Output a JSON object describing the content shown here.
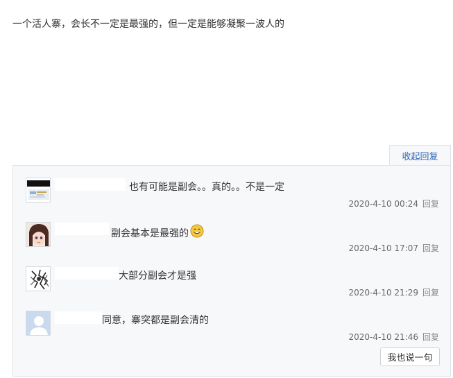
{
  "post": {
    "content": "一个活人寨，会长不一定是最强的，但一定是能够凝聚一波人的"
  },
  "replies_panel": {
    "collapse_label": "收起回复",
    "reply_label": "回复",
    "say_button_label": "我也说一句",
    "items": [
      {
        "text": "也有可能是副会。。真的。。不是一定",
        "time": "2020-4-10 00:24",
        "avatar": "screenshot-avatar"
      },
      {
        "text": "副会基本是最强的",
        "time": "2020-4-10 17:07",
        "avatar": "anime-girl-avatar",
        "emoji": "smile-emoji"
      },
      {
        "text": "大部分副会才是强",
        "time": "2020-4-10 21:29",
        "avatar": "sketch-avatar"
      },
      {
        "text": "同意，寨突都是副会清的",
        "time": "2020-4-10 21:46",
        "avatar": "default-user-avatar"
      }
    ]
  }
}
